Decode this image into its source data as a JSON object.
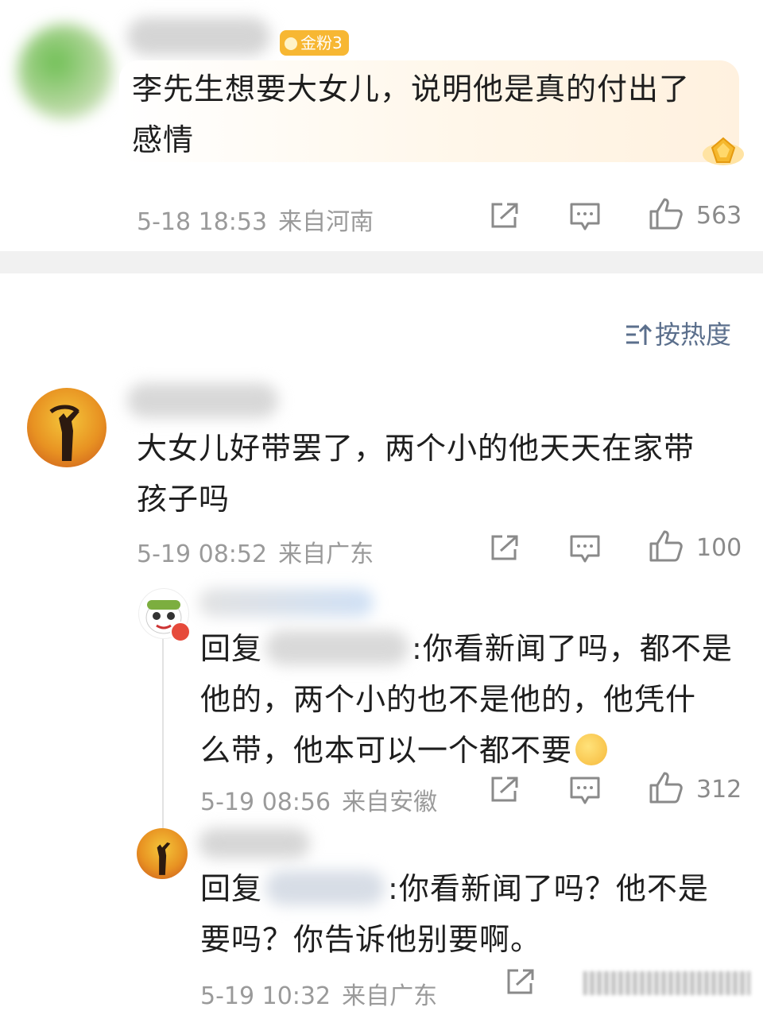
{
  "comments": [
    {
      "badge": "金粉3",
      "text": "李先生想要大女儿，说明他是真的付出了感情",
      "text_line1": "李先生想要大女儿，说明他是真的付出了",
      "text_line2": "感情",
      "time": "5-18 18:53",
      "location": "来自河南",
      "likes": "563"
    },
    {
      "text_line1": "大女儿好带罢了，两个小的他天天在家带",
      "text_line2": "孩子吗",
      "time": "5-19 08:52",
      "location": "来自广东",
      "likes": "100"
    }
  ],
  "replies": [
    {
      "reply_prefix": "回复",
      "text_line1": ":你看新闻了吗，都不是",
      "text_line2": "他的，两个小的也不是他的，他凭什",
      "text_line3": "么带，他本可以一个都不要",
      "time": "5-19 08:56",
      "location": "来自安徽",
      "likes": "312"
    },
    {
      "reply_prefix": "回复",
      "text_line1": ":你看新闻了吗？他不是",
      "text_line2": "要吗？你告诉他别要啊。",
      "time": "5-19 10:32",
      "location": "来自广东"
    }
  ],
  "sort": {
    "label": "按热度",
    "icon": "sort-icon"
  },
  "colors": {
    "sort_accent": "#5b6f8c",
    "badge": "#f7b733",
    "meta": "#9a9a9a"
  }
}
